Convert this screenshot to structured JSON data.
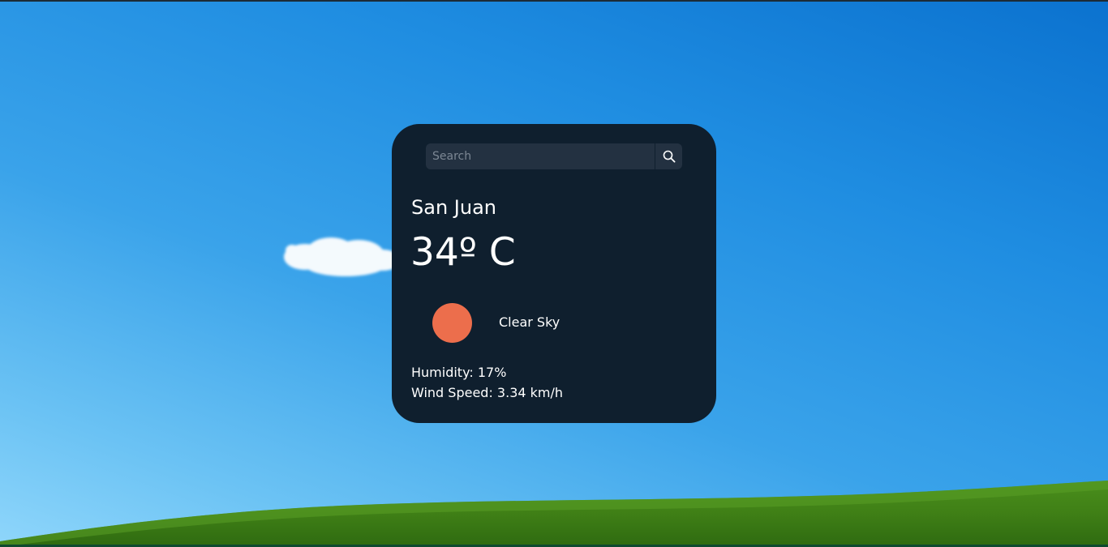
{
  "search": {
    "placeholder": "Search",
    "value": ""
  },
  "weather": {
    "city": "San Juan",
    "temperature": "34º C",
    "description": "Clear Sky",
    "humidity": "Humidity: 17%",
    "wind_speed": "Wind Speed: 3.34 km/h"
  },
  "icons": {
    "search": "search-icon",
    "weather": "sun-icon"
  },
  "colors": {
    "card_background": "#0f1f2e",
    "search_background": "#233141",
    "sun": "#ec6e4c",
    "text": "#ffffff"
  }
}
